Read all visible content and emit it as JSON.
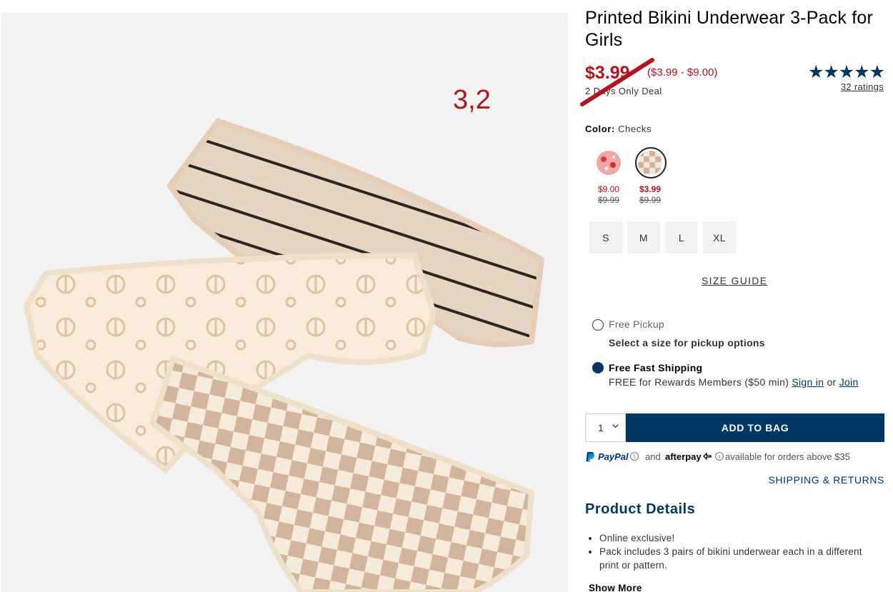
{
  "product": {
    "title": "Printed Bikini Underwear 3-Pack for Girls",
    "sale_price": "$3.99",
    "price_range": "($3.99 - $9.00)",
    "deal_text": "2 Days Only Deal",
    "rating_stars": "★★★★★",
    "ratings_link": "32 ratings",
    "image_overlay_text": "3,2"
  },
  "color": {
    "label": "Color:",
    "selected": "Checks",
    "swatches": [
      {
        "price": "$9.00",
        "original_price": "$9.99",
        "selected": false
      },
      {
        "price": "$3.99",
        "original_price": "$9.99",
        "selected": true
      }
    ]
  },
  "sizes": [
    "S",
    "M",
    "L",
    "XL"
  ],
  "size_guide": "SIZE GUIDE",
  "fulfillment": {
    "pickup_label": "Free Pickup",
    "pickup_sub": "Select a size for pickup options",
    "ship_label": "Free Fast Shipping",
    "ship_sub_prefix": "FREE for Rewards Members ($50 min) ",
    "sign_in": "Sign in",
    "or": " or ",
    "join": "Join"
  },
  "cart": {
    "quantity": "1",
    "add_label": "ADD TO BAG"
  },
  "payment": {
    "paypal": "PayPal",
    "and": "and",
    "afterpay": "afterpay",
    "note": "available for orders above $35"
  },
  "shipping_returns": "SHIPPING & RETURNS",
  "details": {
    "title": "Product Details",
    "items": [
      "Online exclusive!",
      "Pack includes 3 pairs of bikini underwear each in a different print or pattern."
    ],
    "show_more": "Show More"
  },
  "colors": {
    "brand_navy": "#003764",
    "sale_red": "#b5121b"
  }
}
